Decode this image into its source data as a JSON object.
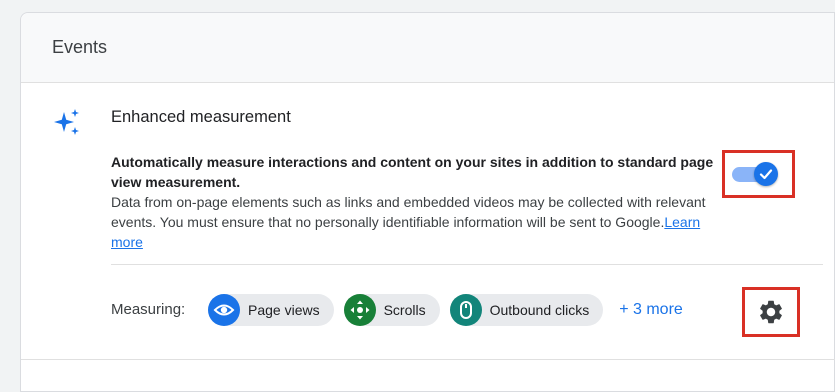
{
  "card": {
    "title": "Events"
  },
  "enhanced": {
    "title": "Enhanced measurement",
    "desc_bold": "Automatically measure interactions and content on your sites in addition to standard page view measurement.",
    "desc_body": "Data from on-page elements such as links and embedded videos may be collected with relevant events. You must ensure that no personally identifiable information will be sent to Google.",
    "learn_more": "Learn more",
    "toggle_on": true
  },
  "measuring": {
    "label": "Measuring:",
    "chips": [
      {
        "label": "Page views",
        "icon": "eye-icon",
        "color": "#1a73e8"
      },
      {
        "label": "Scrolls",
        "icon": "scroll-icon",
        "color": "#188038"
      },
      {
        "label": "Outbound clicks",
        "icon": "mouse-icon",
        "color": "#12857a"
      }
    ],
    "more": "+ 3 more"
  },
  "colors": {
    "accent": "#1a73e8",
    "highlight_box": "#d93025"
  }
}
